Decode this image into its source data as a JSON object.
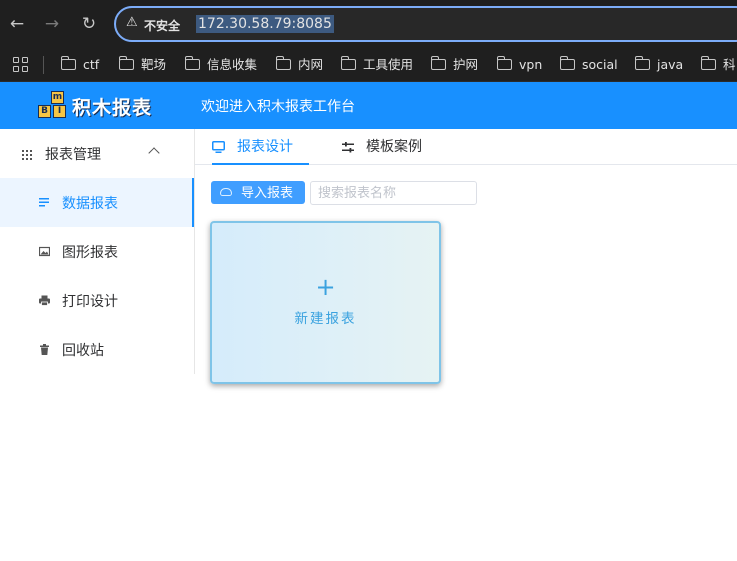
{
  "browser": {
    "insecure_label": "不安全",
    "url": "172.30.58.79:8085",
    "bookmarks": [
      "ctf",
      "靶场",
      "信息收集",
      "内网",
      "工具使用",
      "护网",
      "vpn",
      "social",
      "java",
      "科"
    ]
  },
  "app": {
    "logo_blocks": [
      "m",
      "B",
      "I"
    ],
    "logo_name": "积木报表",
    "welcome": "欢迎进入积木报表工作台"
  },
  "sidebar": {
    "group_label": "报表管理",
    "items": [
      {
        "label": "数据报表",
        "icon": "list-icon",
        "active": true
      },
      {
        "label": "图形报表",
        "icon": "image-icon",
        "active": false
      },
      {
        "label": "打印设计",
        "icon": "printer-icon",
        "active": false
      },
      {
        "label": "回收站",
        "icon": "trash-icon",
        "active": false
      }
    ]
  },
  "tabs": [
    {
      "label": "报表设计",
      "icon": "monitor-icon",
      "active": true
    },
    {
      "label": "模板案例",
      "icon": "sliders-icon",
      "active": false
    }
  ],
  "toolbar": {
    "import_label": "导入报表",
    "search_placeholder": "搜索报表名称"
  },
  "new_card": {
    "plus": "+",
    "label": "新建报表"
  },
  "colors": {
    "brand": "#1890ff",
    "button": "#409eff",
    "card_text": "#3aa2df"
  }
}
